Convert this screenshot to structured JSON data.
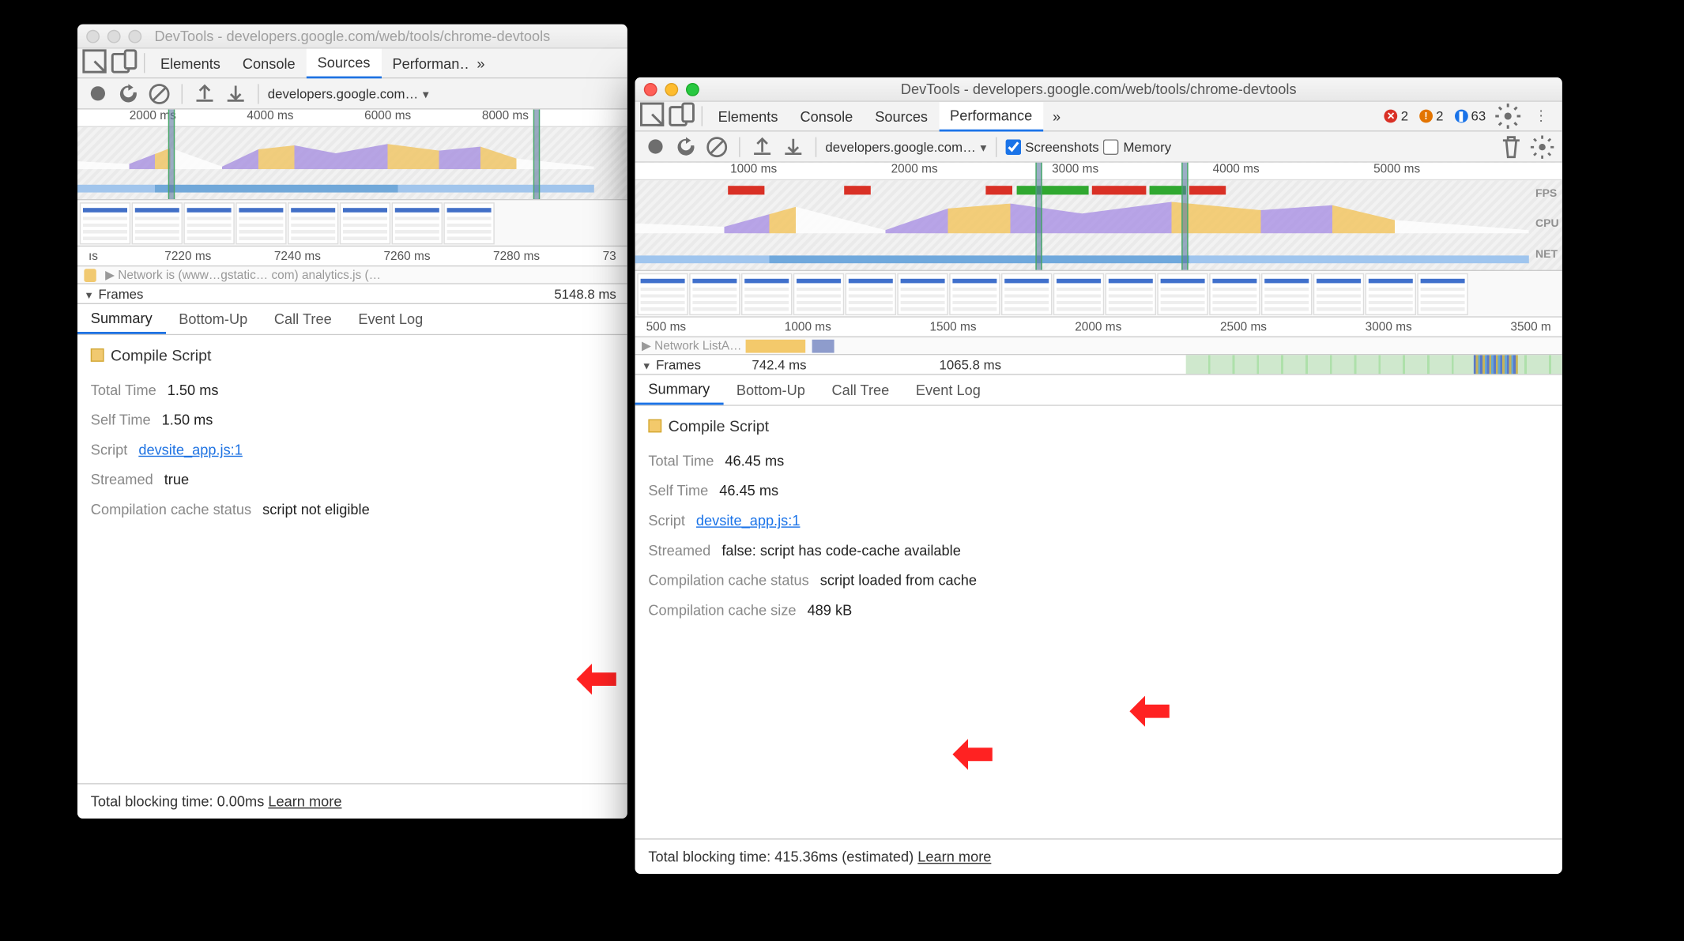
{
  "window_title": "DevTools - developers.google.com/web/tools/chrome-devtools",
  "tabs": [
    "Elements",
    "Console",
    "Sources",
    "Performance"
  ],
  "more_symbol": "»",
  "error_count": "2",
  "warn_count": "2",
  "msg_count": "63",
  "perf_url": "developers.google.com…",
  "opt_screenshots": "Screenshots",
  "opt_memory": "Memory",
  "overview_ticks_right": [
    "1000 ms",
    "2000 ms",
    "3000 ms",
    "4000 ms",
    "5000 ms"
  ],
  "overview_ticks_left": [
    "2000 ms",
    "4000 ms",
    "6000 ms",
    "8000 ms"
  ],
  "overview_labels": {
    "fps": "FPS",
    "cpu": "CPU",
    "net": "NET"
  },
  "ruler_left": [
    "7220 ms",
    "7240 ms",
    "7260 ms",
    "7280 ms",
    "73"
  ],
  "ruler_right": [
    "500 ms",
    "1000 ms",
    "1500 ms",
    "2000 ms",
    "2500 ms",
    "3000 ms",
    "3500 m"
  ],
  "net_truncated_left": "▶ Network   is (www…gstatic…                com)                          analytics.js (…",
  "net_truncated_right": "▶ Network     ListA…",
  "frames_label": "Frames",
  "frames_left_value": "5148.8 ms",
  "frames_right_value1": "742.4 ms",
  "frames_right_value2": "1065.8 ms",
  "detail_tabs": [
    "Summary",
    "Bottom-Up",
    "Call Tree",
    "Event Log"
  ],
  "detail_title": "Compile Script",
  "left": {
    "total_time": {
      "k": "Total Time",
      "v": "1.50 ms"
    },
    "self_time": {
      "k": "Self Time",
      "v": "1.50 ms"
    },
    "script": {
      "k": "Script",
      "v": "devsite_app.js:1"
    },
    "streamed": {
      "k": "Streamed",
      "v": "true"
    },
    "cache_status": {
      "k": "Compilation cache status",
      "v": "script not eligible"
    },
    "footer": "Total blocking time: 0.00ms ",
    "learn": "Learn more"
  },
  "right": {
    "total_time": {
      "k": "Total Time",
      "v": "46.45 ms"
    },
    "self_time": {
      "k": "Self Time",
      "v": "46.45 ms"
    },
    "script": {
      "k": "Script",
      "v": "devsite_app.js:1"
    },
    "streamed": {
      "k": "Streamed",
      "v": "false: script has code-cache available"
    },
    "cache_status": {
      "k": "Compilation cache status",
      "v": "script loaded from cache"
    },
    "cache_size": {
      "k": "Compilation cache size",
      "v": "489 kB"
    },
    "footer": "Total blocking time: 415.36ms (estimated) ",
    "learn": "Learn more"
  }
}
